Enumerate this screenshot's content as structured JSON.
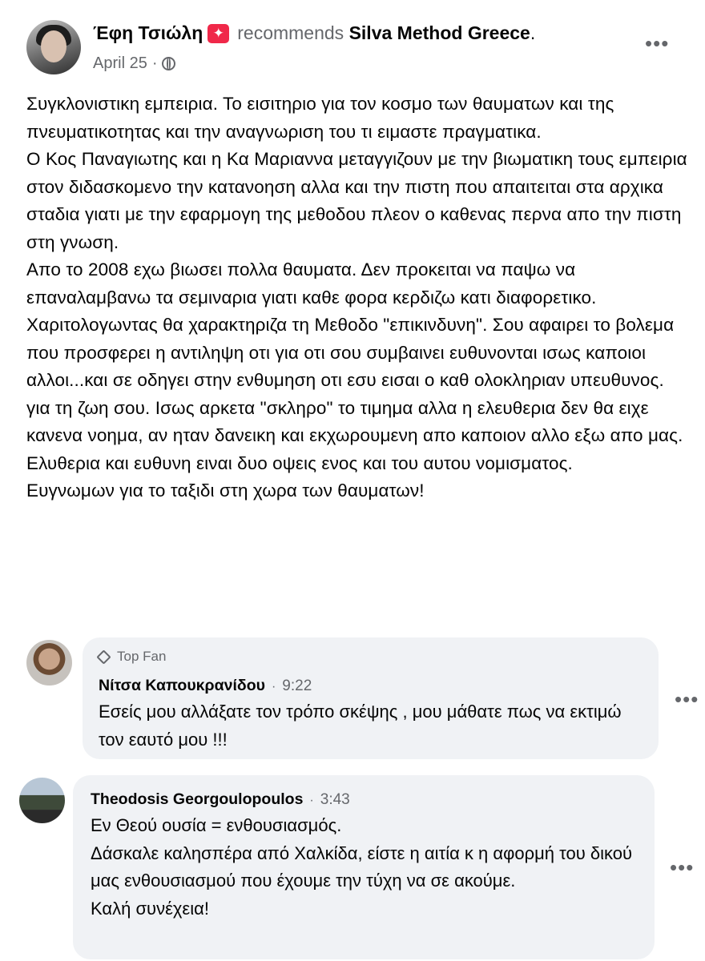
{
  "post": {
    "author": "Έφη Τσιώλη",
    "action": "recommends",
    "page": "Silva Method Greece",
    "date": "April 25",
    "separator": "·",
    "paragraphs": [
      "Συγκλονιστικη εμπειρια. Το εισιτηριο για τον κοσμο των θαυματων και της πνευματικοτητας και την αναγνωριση του τι ειμαστε πραγματικα.",
      "Ο Κος Παναγιωτης και η Κα Μαριαννα μεταγγιζουν με την βιωματικη τους εμπειρια στον διδασκομενο την κατανοηση αλλα και την πιστη που απαιτειται στα αρχικα σταδια γιατι με την εφαρμογη της μεθοδου πλεον ο καθενας περνα απο την πιστη στη γνωση.",
      "Απο το 2008 εχω βιωσει πολλα θαυματα. Δεν προκειται να παψω να επαναλαμβανω τα σεμιναρια γιατι καθε φορα κερδιζω κατι διαφορετικο.",
      "Χαριτολογωντας θα χαρακτηριζα τη Μεθοδο \"επικινδυνη\". Σου αφαιρει το βολεμα που προσφερει η αντιληψη οτι για οτι σου συμβαινει ευθυνονται ισως καποιοι αλλοι...και σε οδηγει στην ενθυμηση οτι εσυ εισαι ο καθ ολοκληριαν υπευθυνος. για τη ζωη σου. Ισως αρκετα \"σκληρο\" το τιμημα αλλα η ελευθερια δεν θα ειχε κανενα νοημα, αν ηταν δανεικη και εκχωρουμενη απο καποιον αλλο εξω απο μας. Ελυθερια και ευθυνη ειναι δυο οψεις ενος και του αυτου νομισματος.",
      "Ευγνωμων για το ταξιδι στη χωρα των θαυματων!"
    ],
    "more_label": "•••",
    "badge_icon": "star-badge-icon"
  },
  "comments": [
    {
      "badge": "Top Fan",
      "name": "Νίτσα Καπουκρανίδου",
      "time": "9:22",
      "lines": [
        "Εσείς μου αλλάξατε τον τρόπο σκέψης , μου μάθατε πως να εκτιμώ τον εαυτό μου !!!"
      ],
      "more_label": "•••"
    },
    {
      "name": "Theodosis Georgoulopoulos",
      "time": "3:43",
      "lines": [
        "Εν Θεού ουσία = ενθουσιασμός.",
        "Δάσκαλε καλησπέρα από Χαλκίδα, είστε η αιτία κ η αφορμή του δικού μας ενθουσιασμού που έχουμε την τύχη να σε ακούμε.",
        "Καλή συνέχεια!"
      ],
      "more_label": "•••"
    }
  ],
  "colors": {
    "text": "#050505",
    "secondary": "#65676b",
    "bubble": "#f0f2f5",
    "badge": "#f02849"
  }
}
